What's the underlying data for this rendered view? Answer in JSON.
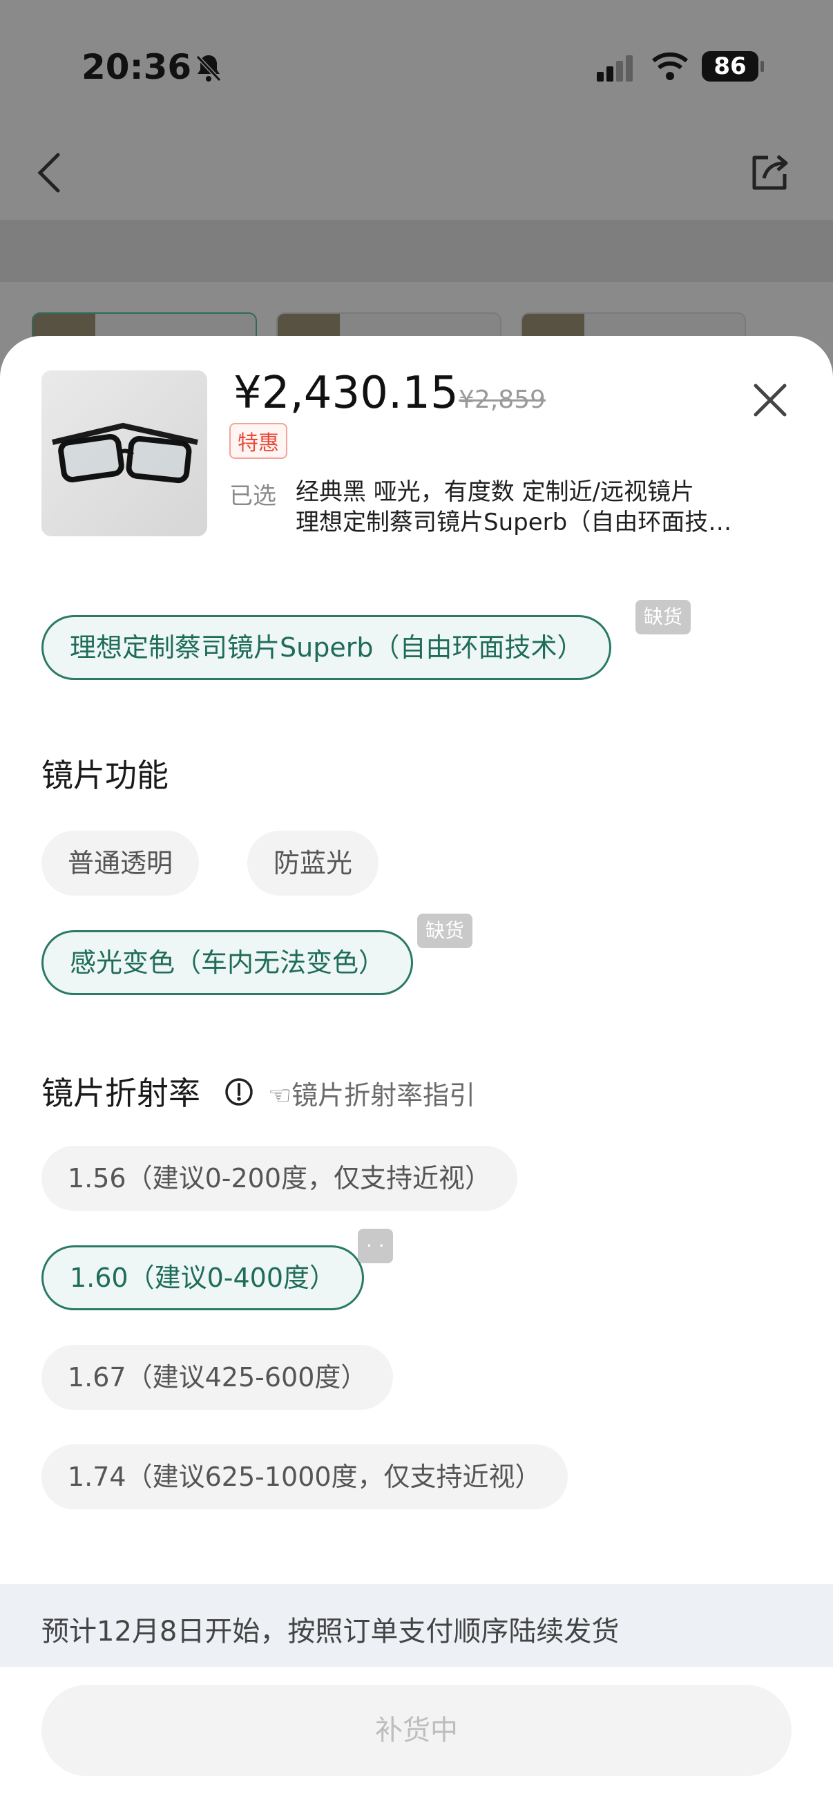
{
  "status_bar": {
    "time": "20:36",
    "battery": "86",
    "icons": [
      "bell-slash-icon",
      "signal-icon",
      "wifi-icon",
      "battery-icon"
    ]
  },
  "background_page": {
    "progress_fraction": 0.18,
    "variant_thumbs": 3
  },
  "product": {
    "price": "¥2,430.15",
    "original_price": "¥2,859",
    "special_tag": "特惠",
    "selected_label": "已选",
    "selected_line1": "经典黑 哑光，有度数 定制近/远视镜片",
    "selected_line2": "理想定制蔡司镜片Superb（自由环面技术）"
  },
  "lens_type": {
    "option_label": "理想定制蔡司镜片Superb（自由环面技术）",
    "badge": "缺货"
  },
  "lens_function": {
    "title": "镜片功能",
    "options": [
      {
        "label": "普通透明"
      },
      {
        "label": "防蓝光"
      },
      {
        "label": "感光变色（车内无法变色）",
        "badge": "缺货"
      }
    ]
  },
  "refractive_index": {
    "title": "镜片折射率",
    "guide": "☜镜片折射率指引",
    "options": [
      {
        "label": "1.56（建议0-200度，仅支持近视）"
      },
      {
        "label": "1.60（建议0-400度）",
        "badge": "· ·"
      },
      {
        "label": "1.67（建议425-600度）"
      },
      {
        "label": "1.74（建议625-1000度，仅支持近视）"
      }
    ]
  },
  "notice": "预计12月8日开始，按照订单支付顺序陆续发货",
  "action_button": "补货中",
  "colors": {
    "accent": "#2a7a66",
    "special": "#e84a3a"
  }
}
